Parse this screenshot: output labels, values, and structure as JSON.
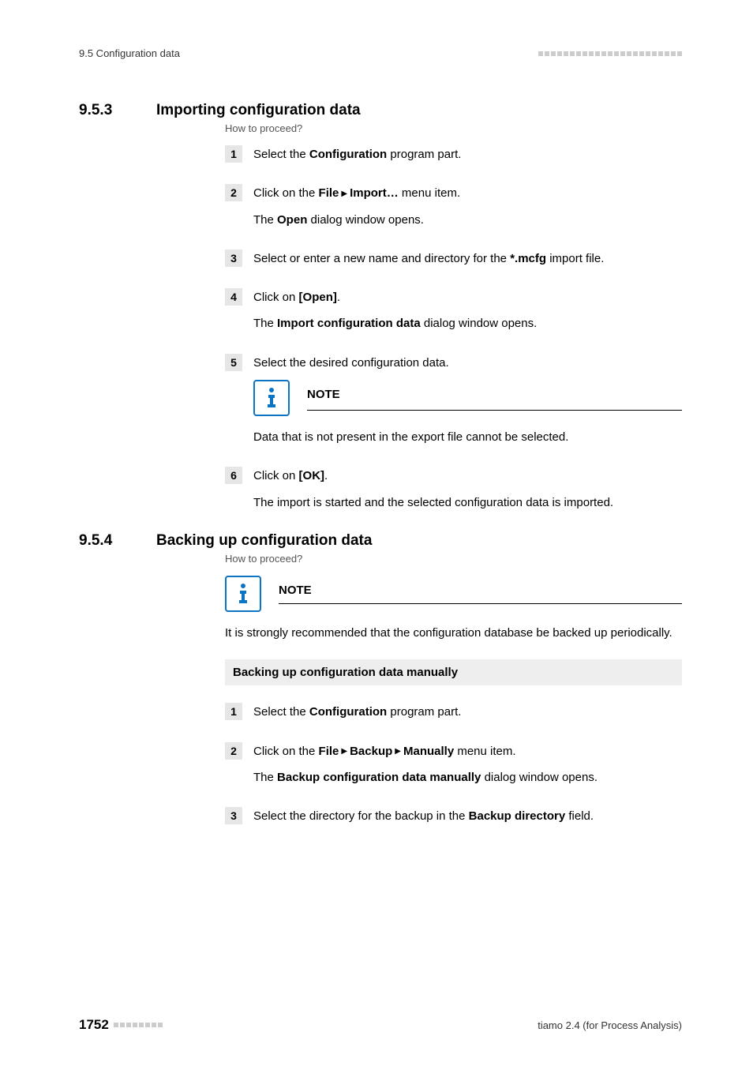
{
  "header": {
    "section_ref": "9.5 Configuration data"
  },
  "sec1": {
    "num": "9.5.3",
    "title": "Importing configuration data",
    "howto": "How to proceed?",
    "steps": {
      "s1": {
        "p1_a": "Select the ",
        "p1_b": "Configuration",
        "p1_c": " program part."
      },
      "s2": {
        "p1_a": "Click on the ",
        "p1_b": "File",
        "p1_c": "Import…",
        "p1_d": " menu item.",
        "p2_a": "The ",
        "p2_b": "Open",
        "p2_c": " dialog window opens."
      },
      "s3": {
        "p1_a": "Select or enter a new name and directory for the ",
        "p1_b": "*.mcfg",
        "p1_c": " import file."
      },
      "s4": {
        "p1_a": "Click on ",
        "p1_b": "[Open]",
        "p1_c": ".",
        "p2_a": "The ",
        "p2_b": "Import configuration data",
        "p2_c": " dialog window opens."
      },
      "s5": {
        "p1": "Select the desired configuration data.",
        "note_title": "NOTE",
        "note_text": "Data that is not present in the export file cannot be selected."
      },
      "s6": {
        "p1_a": "Click on ",
        "p1_b": "[OK]",
        "p1_c": ".",
        "p2": "The import is started and the selected configuration data is imported."
      }
    }
  },
  "sec2": {
    "num": "9.5.4",
    "title": "Backing up configuration data",
    "howto": "How to proceed?",
    "note_title": "NOTE",
    "note_text": "It is strongly recommended that the configuration database be backed up periodically.",
    "sub_heading": "Backing up configuration data manually",
    "steps": {
      "s1": {
        "p1_a": "Select the ",
        "p1_b": "Configuration",
        "p1_c": " program part."
      },
      "s2": {
        "p1_a": "Click on the ",
        "p1_b": "File",
        "p1_c": "Backup",
        "p1_d": "Manually",
        "p1_e": " menu item.",
        "p2_a": "The ",
        "p2_b": "Backup configuration data manually",
        "p2_c": " dialog window opens."
      },
      "s3": {
        "p1_a": "Select the directory for the backup in the ",
        "p1_b": "Backup directory",
        "p1_c": " field."
      }
    }
  },
  "footer": {
    "page": "1752",
    "product": "tiamo 2.4 (for Process Analysis)"
  }
}
